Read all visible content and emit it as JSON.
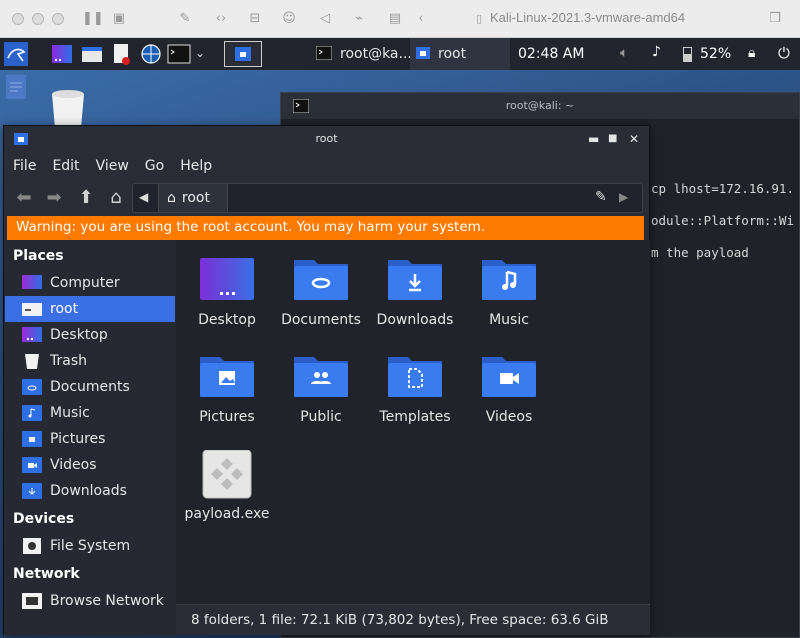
{
  "vm_bar": {
    "title": "Kali-Linux-2021.3-vmware-amd64"
  },
  "taskbar": {
    "tasks": [
      {
        "label": "root@ka..."
      },
      {
        "label": "root"
      }
    ],
    "clock": "02:48 AM",
    "battery": "52%"
  },
  "terminal": {
    "title": "root@kali: ~",
    "lines": [
      "cp lhost=172.16.91.",
      "odule::Platform::Wi",
      "m the payload"
    ]
  },
  "fm": {
    "title": "root",
    "menu": [
      "File",
      "Edit",
      "View",
      "Go",
      "Help"
    ],
    "crumb": "root",
    "warning": "Warning: you are using the root account. You may harm your system.",
    "sidebar": {
      "places_header": "Places",
      "places": [
        {
          "label": "Computer",
          "icon": "computer-icon"
        },
        {
          "label": "root",
          "icon": "home-folder-icon",
          "selected": true
        },
        {
          "label": "Desktop",
          "icon": "desktop-icon"
        },
        {
          "label": "Trash",
          "icon": "trash-icon"
        },
        {
          "label": "Documents",
          "icon": "documents-folder-icon"
        },
        {
          "label": "Music",
          "icon": "music-folder-icon"
        },
        {
          "label": "Pictures",
          "icon": "pictures-folder-icon"
        },
        {
          "label": "Videos",
          "icon": "videos-folder-icon"
        },
        {
          "label": "Downloads",
          "icon": "downloads-folder-icon"
        }
      ],
      "devices_header": "Devices",
      "devices": [
        {
          "label": "File System",
          "icon": "drive-icon"
        }
      ],
      "network_header": "Network",
      "network": [
        {
          "label": "Browse Network",
          "icon": "network-icon"
        }
      ]
    },
    "files": [
      {
        "label": "Desktop",
        "icon": "desktop-folder-icon"
      },
      {
        "label": "Documents",
        "icon": "documents-folder-icon"
      },
      {
        "label": "Downloads",
        "icon": "downloads-folder-icon"
      },
      {
        "label": "Music",
        "icon": "music-folder-icon"
      },
      {
        "label": "Pictures",
        "icon": "pictures-folder-icon"
      },
      {
        "label": "Public",
        "icon": "public-folder-icon"
      },
      {
        "label": "Templates",
        "icon": "templates-folder-icon"
      },
      {
        "label": "Videos",
        "icon": "videos-folder-icon"
      },
      {
        "label": "payload.exe",
        "icon": "executable-file-icon"
      }
    ],
    "status": "8 folders, 1 file: 72.1 KiB (73,802 bytes), Free space: 63.6 GiB"
  },
  "colors": {
    "accent": "#3a6fe6",
    "warning": "#ff7b00",
    "folder": "#2f6fe4"
  }
}
